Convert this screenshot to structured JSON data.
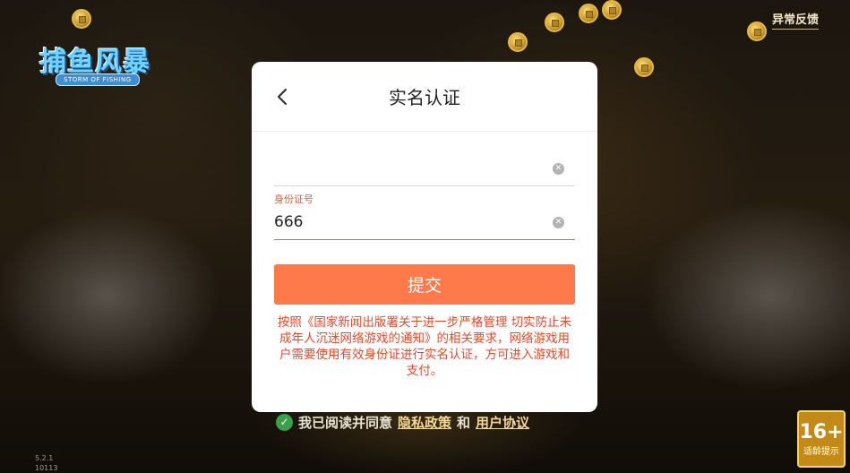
{
  "top_bar": {
    "feedback_label": "异常反馈"
  },
  "logo": {
    "title": "捕鱼风暴",
    "subtitle": "STORM OF FISHING"
  },
  "modal": {
    "title": "实名认证",
    "name_field": {
      "value": ""
    },
    "id_field": {
      "label": "身份证号",
      "value": "666"
    },
    "submit_label": "提交",
    "notice": "按照《国家新闻出版署关于进一步严格管理 切实防止未成年人沉迷网络游戏的通知》的相关要求，网络游戏用户需要使用有效身份证进行实名认证，方可进入游戏和支付。"
  },
  "agreement": {
    "prefix": "我已阅读并同意",
    "privacy_link": "隐私政策",
    "conjunction": "和",
    "user_link": "用户协议"
  },
  "footer": {
    "version_line1": "5.2.1",
    "version_line2": "10113"
  },
  "age_rating": {
    "number": "16+",
    "label": "适龄提示"
  },
  "colors": {
    "accent": "#ff7a4a",
    "notice_text": "#e34a2c",
    "check_green": "#3aa14a"
  }
}
